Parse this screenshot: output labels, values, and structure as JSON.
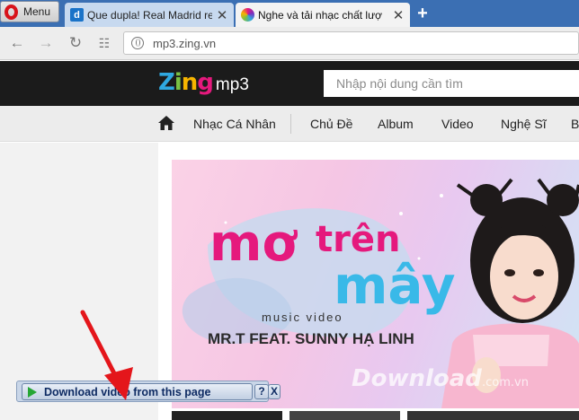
{
  "browser": {
    "menu_label": "Menu",
    "tabs": [
      {
        "title": "Que dupla! Real Madrid re",
        "favicon_letter": "d"
      },
      {
        "title": "Nghe và tải nhạc chất lượ"
      }
    ],
    "newtab_glyph": "+",
    "close_glyph": "✕",
    "url": "mp3.zing.vn"
  },
  "site": {
    "logo_letters": [
      "Z",
      "i",
      "n",
      "g"
    ],
    "logo_suffix": "mp3",
    "search_placeholder": "Nhập nội dung cần tìm",
    "nav": [
      "Nhạc Cá Nhân",
      "Chủ Đề",
      "Album",
      "Video",
      "Nghệ Sĩ",
      "B"
    ]
  },
  "banner": {
    "title_line1": "mơ",
    "title_line2": "trên",
    "title_line3": "mây",
    "subtitle": "music video",
    "artists": "MR.T  FEAT. SUNNY HẠ LINH"
  },
  "watermark": {
    "main": "Download",
    "suffix": ".com.vn"
  },
  "download_bar": {
    "label": "Download video from this page",
    "help": "?",
    "close": "X"
  },
  "colors": {
    "tabbar": "#3b6fb3",
    "site_header": "#1b1b1b",
    "accent_pink": "#e5197d",
    "annotation_arrow": "#e4161b"
  }
}
